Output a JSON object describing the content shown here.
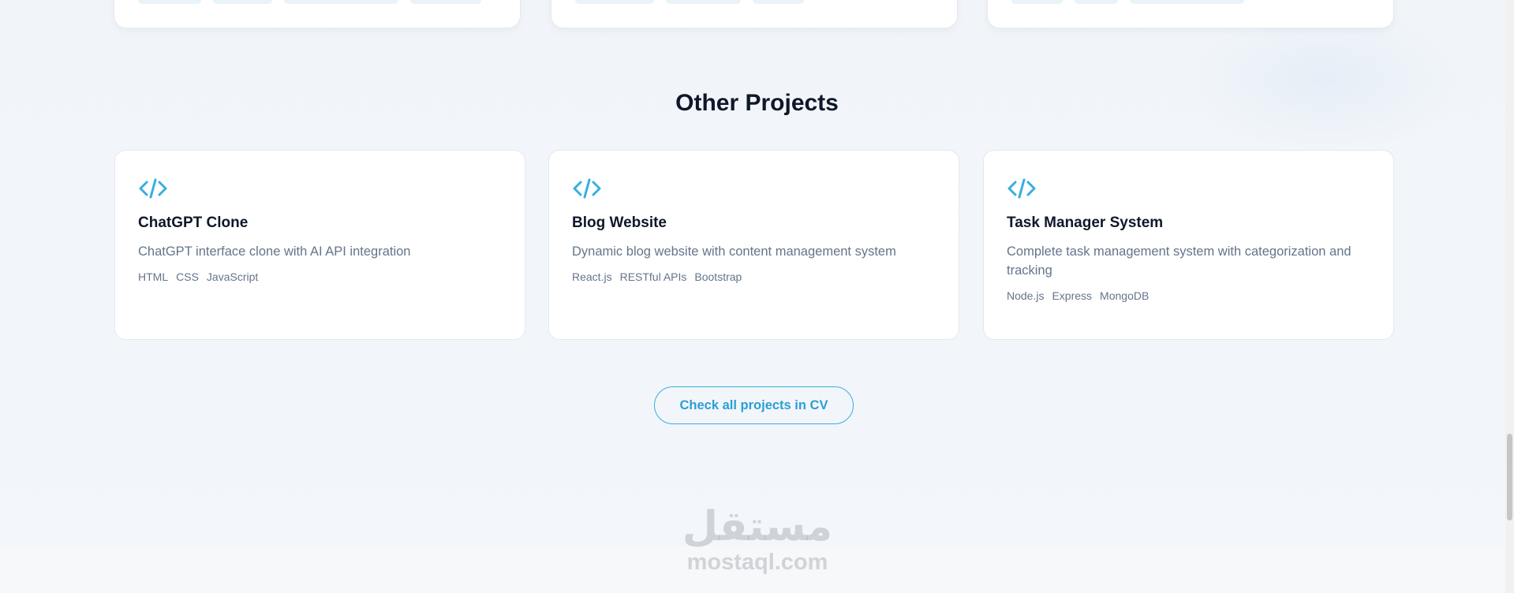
{
  "section": {
    "title": "Other Projects"
  },
  "projects": [
    {
      "title": "ChatGPT Clone",
      "description": "ChatGPT interface clone with AI API integration",
      "tags": [
        "HTML",
        "CSS",
        "JavaScript"
      ]
    },
    {
      "title": "Blog Website",
      "description": "Dynamic blog website with content management system",
      "tags": [
        "React.js",
        "RESTful APIs",
        "Bootstrap"
      ]
    },
    {
      "title": "Task Manager System",
      "description": "Complete task management system with categorization and tracking",
      "tags": [
        "Node.js",
        "Express",
        "MongoDB"
      ]
    }
  ],
  "cta": {
    "label": "Check all projects in CV"
  },
  "watermark": {
    "arabic": "مستقل",
    "latin": "mostaql.com"
  },
  "colors": {
    "accent": "#2a9fd6",
    "title": "#0f172a",
    "muted": "#64748b"
  },
  "icons": {
    "project_icon": "code-icon"
  }
}
